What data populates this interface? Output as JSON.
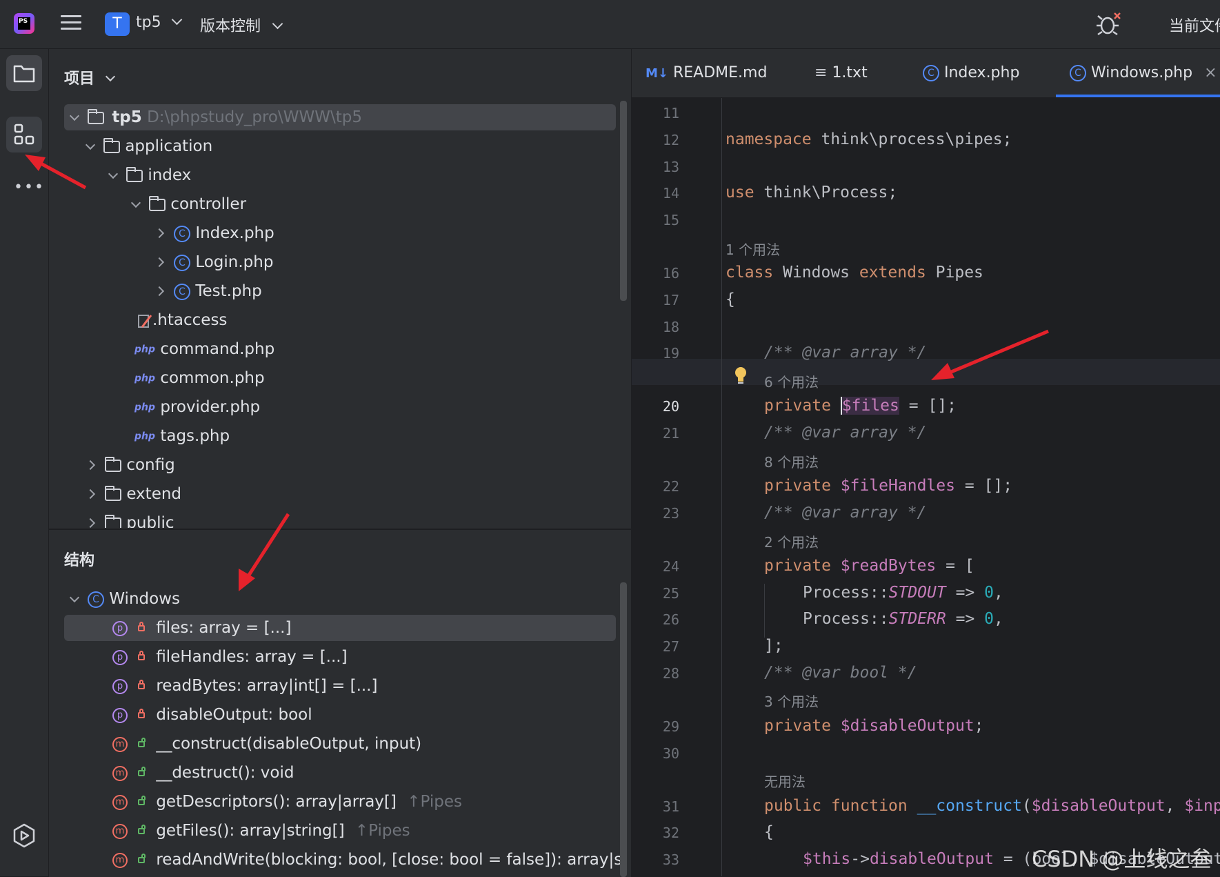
{
  "titlebar": {
    "logo_text": "PS",
    "project_badge": "T",
    "project_name": "tp5",
    "vcs_label": "版本控制",
    "right_label": "当前文件"
  },
  "project_panel": {
    "title": "项目",
    "root_name": "tp5",
    "root_path": "D:\\phpstudy_pro\\WWW\\tp5",
    "items": [
      {
        "label": "application"
      },
      {
        "label": "index"
      },
      {
        "label": "controller"
      },
      {
        "label": "Index.php"
      },
      {
        "label": "Login.php"
      },
      {
        "label": "Test.php"
      },
      {
        "label": ".htaccess"
      },
      {
        "label": "command.php"
      },
      {
        "label": "common.php"
      },
      {
        "label": "provider.php"
      },
      {
        "label": "tags.php"
      },
      {
        "label": "config"
      },
      {
        "label": "extend"
      },
      {
        "label": "public"
      }
    ],
    "php_badge": "php"
  },
  "structure_panel": {
    "title": "结构",
    "class_name": "Windows",
    "members": [
      {
        "kind": "p",
        "text": "files: array = [...]",
        "inherit": ""
      },
      {
        "kind": "p",
        "text": "fileHandles: array = [...]",
        "inherit": ""
      },
      {
        "kind": "p",
        "text": "readBytes: array|int[] = [...]",
        "inherit": ""
      },
      {
        "kind": "p",
        "text": "disableOutput: bool",
        "inherit": ""
      },
      {
        "kind": "m",
        "text": "__construct(disableOutput, input)",
        "inherit": ""
      },
      {
        "kind": "m",
        "text": "__destruct(): void",
        "inherit": ""
      },
      {
        "kind": "m",
        "text": "getDescriptors(): array|array[]",
        "inherit": "↑Pipes"
      },
      {
        "kind": "m",
        "text": "getFiles(): array|string[]",
        "inherit": "↑Pipes"
      },
      {
        "kind": "m",
        "text": "readAndWrite(blocking: bool, [close: bool = false]): array|string[]",
        "inherit": "↑"
      }
    ]
  },
  "tabs": [
    {
      "icon": "M↓",
      "label": "README.md"
    },
    {
      "icon": "≡",
      "label": "1.txt"
    },
    {
      "icon": "C",
      "label": "Index.php"
    },
    {
      "icon": "C",
      "label": "Windows.php",
      "close": "×"
    }
  ],
  "editor": {
    "line_numbers": [
      "11",
      "12",
      "13",
      "14",
      "15",
      "16",
      "17",
      "18",
      "19",
      "20",
      "21",
      "22",
      "23",
      "24",
      "25",
      "26",
      "27",
      "28",
      "29",
      "30",
      "31",
      "32",
      "33"
    ],
    "hints": {
      "usage_1": "1 个用法",
      "usage_6": "6 个用法",
      "usage_8": "8 个用法",
      "usage_2": "2 个用法",
      "usage_3": "3 个用法",
      "usage_0": "无用法"
    },
    "code": {
      "l12_kw": "namespace",
      "l12_rest": " think\\process\\pipes;",
      "l14_kw": "use",
      "l14_rest": " think\\Process;",
      "l16_kw1": "class",
      "l16_name": " Windows ",
      "l16_kw2": "extends",
      "l16_rest": " Pipes",
      "l17": "{",
      "l19": "/** @var array */",
      "l20_kw": "private",
      "l20_var": "$files",
      "l20_rest": " = [];",
      "l21": "/** @var array */",
      "l22_kw": "private",
      "l22_var": "$fileHandles",
      "l22_rest": " = [];",
      "l23": "/** @var array */",
      "l24_kw": "private",
      "l24_var": "$readBytes",
      "l24_rest": " = [",
      "l25_a": "Process::",
      "l25_c": "STDOUT",
      "l25_b": " => ",
      "l25_n": "0",
      "l25_e": ",",
      "l26_a": "Process::",
      "l26_c": "STDERR",
      "l26_b": " => ",
      "l26_n": "0",
      "l26_e": ",",
      "l27": "];",
      "l28": "/** @var bool */",
      "l29_kw": "private",
      "l29_var": "$disableOutput",
      "l29_rest": ";",
      "l31_kw1": "public",
      "l31_kw2": "function",
      "l31_fn": "__construct",
      "l31_p": "(",
      "l31_v1": "$disableOutput",
      "l31_c": ", ",
      "l31_v2": "$inp",
      "l32": "{",
      "l33_a": "$this",
      "l33_b": "->",
      "l33_c": "disableOutput",
      "l33_d": " = (bool) $disableOutput;"
    }
  },
  "watermark": "CSDN @上线之叁"
}
